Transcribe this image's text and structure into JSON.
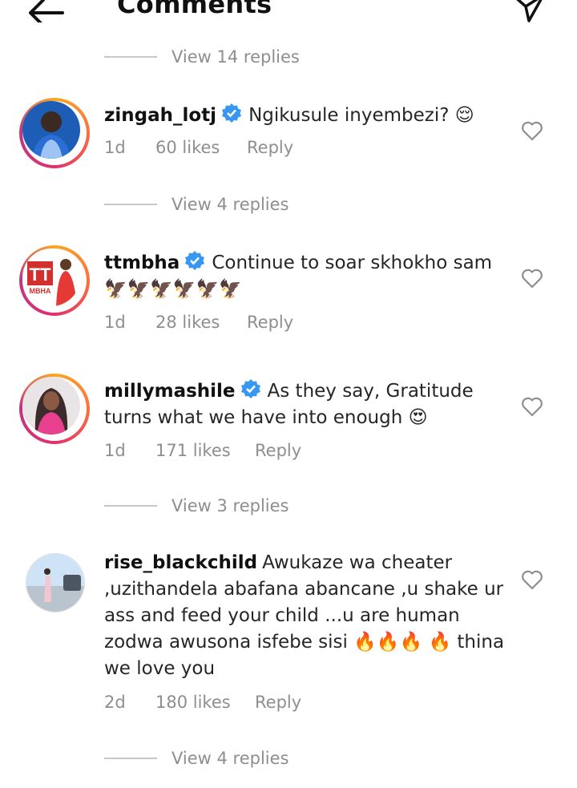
{
  "header": {
    "title": "Comments"
  },
  "view_replies": {
    "top": "View 14 replies",
    "c1": "View 4 replies",
    "c3": "View 3 replies",
    "c4": "View 4 replies"
  },
  "comments": [
    {
      "username": "zingah_lotj",
      "verified": true,
      "text": "Ngikusule inyembezi? 😌",
      "age": "1d",
      "likes": "60 likes",
      "reply": "Reply"
    },
    {
      "username": "ttmbha",
      "verified": true,
      "text": "Continue to soar skhokho sam 🦅🦅🦅🦅🦅🦅",
      "age": "1d",
      "likes": "28 likes",
      "reply": "Reply",
      "avatar_text": "TT MBHA"
    },
    {
      "username": "millymashile",
      "verified": true,
      "text": "As they say, Gratitude turns what we have into enough 😍",
      "age": "1d",
      "likes": "171 likes",
      "reply": "Reply"
    },
    {
      "username": "rise_blackchild",
      "verified": false,
      "text": "Awukaze wa cheater ,uzithandela abafana abancane ,u shake ur ass and feed your child ...u are human zodwa awusona isfebe sisi 🔥🔥🔥 🔥 thina we love you",
      "age": "2d",
      "likes": "180 likes",
      "reply": "Reply"
    }
  ],
  "icons": {
    "back": "arrow-left-icon",
    "send": "paper-plane-icon",
    "verified": "verified-badge-icon",
    "like": "heart-outline-icon"
  },
  "colors": {
    "verified": "#3897f0",
    "muted": "#8e8e8e",
    "text": "#262626"
  }
}
